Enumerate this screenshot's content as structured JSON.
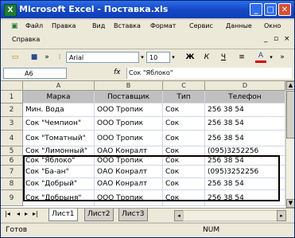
{
  "window": {
    "title": "Microsoft Excel - Поставка.xls",
    "app_icon": "excel-app-icon"
  },
  "menu": {
    "items": [
      "Файл",
      "Правка",
      "Вид",
      "Вставка",
      "Формат",
      "Сервис",
      "Данные",
      "Окно"
    ],
    "row2": [
      "Справка"
    ]
  },
  "toolbar": {
    "font": "Arial",
    "size": "10",
    "bold": "Ж",
    "italic": "К",
    "underline": "Ч"
  },
  "formula_bar": {
    "name_box": "A6",
    "fx": "fx",
    "content": "Сок \"Яблоко\""
  },
  "columns": [
    "A",
    "B",
    "C",
    "D"
  ],
  "rows": [
    {
      "num": "1",
      "cells": [
        "Марка",
        "Поставщик",
        "Тип",
        "Телефон"
      ]
    },
    {
      "num": "2",
      "cells": [
        "Мин. Вода",
        "ООО Тропик",
        "Сок",
        "256 38 54"
      ]
    },
    {
      "num": "3",
      "cells": [
        "Сок \"Чемпион\"",
        "ООО Тропик",
        "Сок",
        "256 38 54"
      ]
    },
    {
      "num": "4",
      "cells": [
        "Сок \"Томатный\"",
        "ООО Тропик",
        "Сок",
        "256 38 54"
      ]
    },
    {
      "num": "5",
      "cells": [
        "Сок \"Лимонный\"",
        "ОАО Конралт",
        "Сок",
        "(095)3252256"
      ]
    },
    {
      "num": "6",
      "cells": [
        "Сок \"Яблоко\"",
        "ООО Тропик",
        "Сок",
        "256 38 54"
      ]
    },
    {
      "num": "7",
      "cells": [
        "Сок \"Ба-ан\"",
        "ОАО Конралт",
        "Сок",
        "(095)3252256"
      ]
    },
    {
      "num": "8",
      "cells": [
        "Сок \"Добрый\"",
        "ОАО Конралт",
        "Сок",
        "256 38 54"
      ]
    },
    {
      "num": "9",
      "cells": [
        "Сок \"Добрыня\"",
        "ООО Тропик",
        "Сок",
        "256 38 54"
      ]
    }
  ],
  "sheets": [
    {
      "label": "Лист1",
      "active": true
    },
    {
      "label": "Лист2",
      "active": false
    },
    {
      "label": "Лист3",
      "active": false
    }
  ],
  "status": {
    "left": "Готов",
    "num": "NUM"
  },
  "colors": {
    "title_bar": "#1648c7",
    "header_row": "#c0c0c0",
    "chrome": "#ece9d8"
  }
}
